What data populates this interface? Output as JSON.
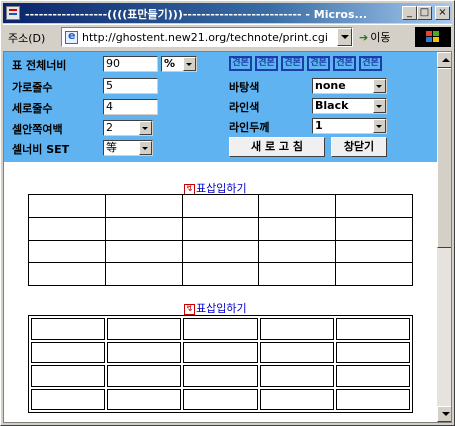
{
  "window": {
    "title": "------------------((((표만들기)))-------------------------- - Micros...",
    "min_label": "_",
    "max_label": "□",
    "close_label": "×"
  },
  "address_bar": {
    "label": "주소(D)",
    "url": "http://ghostent.new21.org/technote/print.cgi",
    "go_label": "이동"
  },
  "form": {
    "table_width_label": "표 전체너비",
    "table_width_value": "90",
    "width_unit_value": "%",
    "cols_label": "가로줄수",
    "cols_value": "5",
    "rows_label": "세로줄수",
    "rows_value": "4",
    "padding_label": "셀안쪽여백",
    "padding_value": "2",
    "cell_width_label": "셀너비 SET",
    "cell_width_value": "等",
    "samples": [
      "견본",
      "견본",
      "견본",
      "견본",
      "견본",
      "견본"
    ],
    "bgcolor_label": "바탕색",
    "bgcolor_value": "none",
    "linecolor_label": "라인색",
    "linecolor_value": "Black",
    "linewidth_label": "라인두께",
    "linewidth_value": "1",
    "refresh_button": "새 로 고 침",
    "close_button": "창닫기"
  },
  "tables": [
    {
      "insert_label": "표삽입하기",
      "rows": 4,
      "cols": 5,
      "style": "collapsed"
    },
    {
      "insert_label": "표삽입하기",
      "rows": 4,
      "cols": 5,
      "style": "separate"
    }
  ],
  "colors": {
    "form_background": "#5fb3f0",
    "title_gradient_start": "#0a246a",
    "link_blue": "#0000cc"
  }
}
